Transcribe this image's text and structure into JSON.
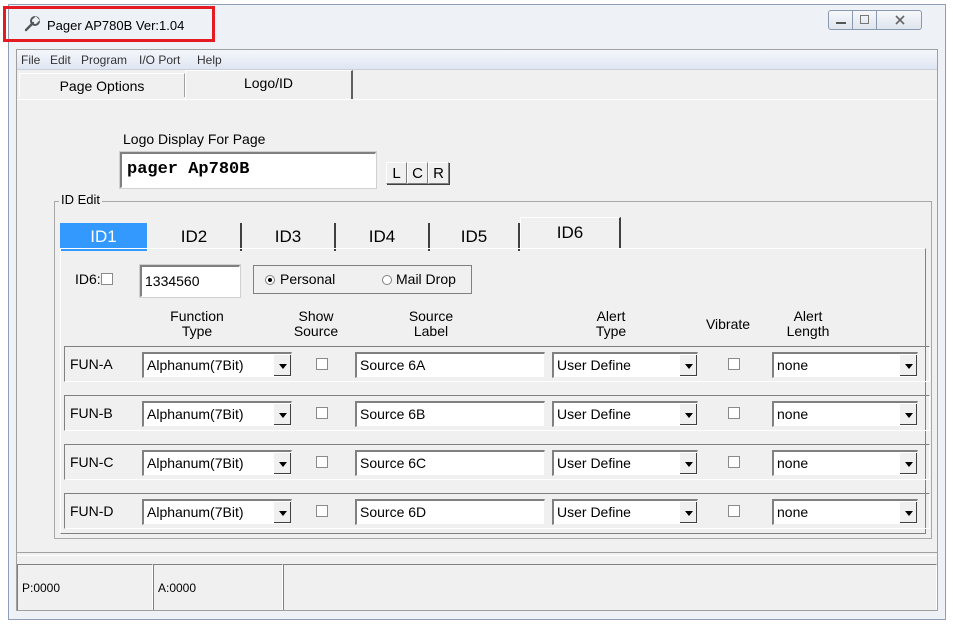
{
  "window": {
    "title": "Pager AP780B Ver:1.04"
  },
  "menu": [
    "File",
    "Edit",
    "Program",
    "I/O Port",
    "Help"
  ],
  "tabs": [
    {
      "label": "Page Options"
    },
    {
      "label": "Logo/ID"
    }
  ],
  "logo": {
    "label": "Logo Display For Page",
    "value": "pager Ap780B",
    "align_buttons": [
      "L",
      "C",
      "R"
    ]
  },
  "id_edit": {
    "group_label": "ID Edit",
    "id_tabs": [
      "ID1",
      "ID2",
      "ID3",
      "ID4",
      "ID5",
      "ID6"
    ],
    "selected_tab": "ID1",
    "active_tab": "ID6",
    "id_checkbox_label": "ID6:",
    "id_value": "1334560",
    "radio_personal": "Personal",
    "radio_maildrop": "Mail Drop",
    "headers": {
      "function_type": [
        "Function",
        "Type"
      ],
      "show_source": [
        "Show",
        "Source"
      ],
      "source_label": [
        "Source",
        "Label"
      ],
      "alert_type": [
        "Alert",
        "Type"
      ],
      "vibrate": [
        "Vibrate"
      ],
      "alert_length": [
        "Alert",
        "Length"
      ]
    },
    "rows": [
      {
        "fun": "FUN-A",
        "type": "Alphanum(7Bit)",
        "source": "Source 6A",
        "alert": "User Define",
        "length": "none"
      },
      {
        "fun": "FUN-B",
        "type": "Alphanum(7Bit)",
        "source": "Source 6B",
        "alert": "User Define",
        "length": "none"
      },
      {
        "fun": "FUN-C",
        "type": "Alphanum(7Bit)",
        "source": "Source 6C",
        "alert": "User Define",
        "length": "none"
      },
      {
        "fun": "FUN-D",
        "type": "Alphanum(7Bit)",
        "source": "Source 6D",
        "alert": "User Define",
        "length": "none"
      }
    ]
  },
  "status": {
    "p": "P:0000",
    "a": "A:0000"
  },
  "colors": {
    "selected_tab": "#3399ff",
    "highlight_border": "#e51b24"
  }
}
